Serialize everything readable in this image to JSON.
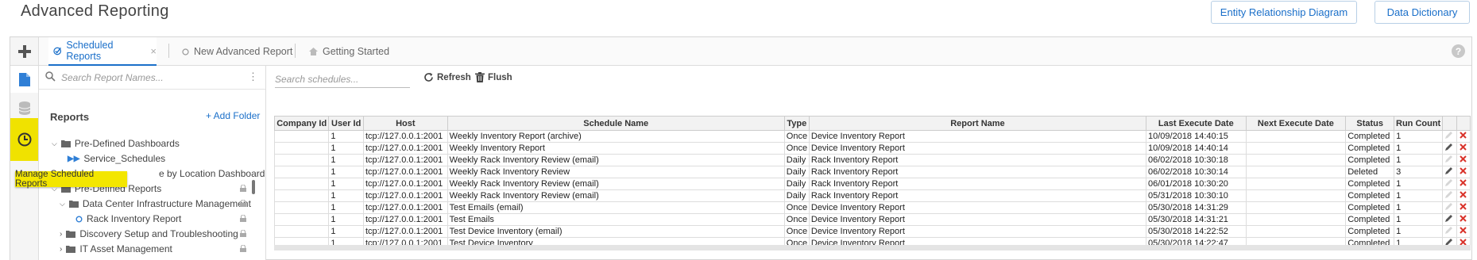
{
  "header": {
    "title": "Advanced Reporting",
    "erd_button": "Entity Relationship Diagram",
    "dictionary_button": "Data Dictionary"
  },
  "tabs": [
    {
      "label": "Scheduled Reports",
      "close": "×"
    },
    {
      "label": "New Advanced Report"
    },
    {
      "label": "Getting Started"
    }
  ],
  "help": "?",
  "tooltip": "Manage Scheduled Reports",
  "tree": {
    "search_placeholder": "Search Report Names...",
    "menu_glyph": "⋮",
    "heading": "Reports",
    "add_folder": "+ Add Folder",
    "items": [
      {
        "label": "Pre-Defined Dashboards"
      },
      {
        "label": "Service_Schedules"
      },
      {
        "label": "e by Location Dashboard"
      },
      {
        "label": "Pre-Defined Reports"
      },
      {
        "label": "Data Center Infrastructure Management"
      },
      {
        "label": "Rack Inventory Report"
      },
      {
        "label": "Discovery Setup and Troubleshooting"
      },
      {
        "label": "IT Asset Management"
      }
    ]
  },
  "toolbar": {
    "search_placeholder": "Search schedules...",
    "refresh": "Refresh",
    "flush": "Flush"
  },
  "table": {
    "columns": [
      "Company Id",
      "User Id",
      "Host",
      "Schedule Name",
      "Type",
      "Report Name",
      "Last Execute Date",
      "Next Execute Date",
      "Status",
      "Run Count",
      "",
      ""
    ],
    "rows": [
      {
        "company": "",
        "user": "1",
        "host": "tcp://127.0.0.1:2001",
        "name": "Weekly Inventory Report (archive)",
        "type": "Once",
        "report": "Device Inventory Report",
        "last": "10/09/2018 14:40:15",
        "next": "",
        "status": "Completed",
        "count": "1",
        "editable": false
      },
      {
        "company": "",
        "user": "1",
        "host": "tcp://127.0.0.1:2001",
        "name": "Weekly Inventory Report",
        "type": "Once",
        "report": "Device Inventory Report",
        "last": "10/09/2018 14:40:14",
        "next": "",
        "status": "Completed",
        "count": "1",
        "editable": true
      },
      {
        "company": "",
        "user": "1",
        "host": "tcp://127.0.0.1:2001",
        "name": "Weekly Rack Inventory Review (email)",
        "type": "Daily",
        "report": "Rack Inventory Report",
        "last": "06/02/2018 10:30:18",
        "next": "",
        "status": "Completed",
        "count": "1",
        "editable": false
      },
      {
        "company": "",
        "user": "1",
        "host": "tcp://127.0.0.1:2001",
        "name": "Weekly Rack Inventory Review",
        "type": "Daily",
        "report": "Rack Inventory Report",
        "last": "06/02/2018 10:30:14",
        "next": "",
        "status": "Deleted",
        "count": "3",
        "editable": true
      },
      {
        "company": "",
        "user": "1",
        "host": "tcp://127.0.0.1:2001",
        "name": "Weekly Rack Inventory Review (email)",
        "type": "Daily",
        "report": "Rack Inventory Report",
        "last": "06/01/2018 10:30:20",
        "next": "",
        "status": "Completed",
        "count": "1",
        "editable": false
      },
      {
        "company": "",
        "user": "1",
        "host": "tcp://127.0.0.1:2001",
        "name": "Weekly Rack Inventory Review (email)",
        "type": "Daily",
        "report": "Rack Inventory Report",
        "last": "05/31/2018 10:30:10",
        "next": "",
        "status": "Completed",
        "count": "1",
        "editable": false
      },
      {
        "company": "",
        "user": "1",
        "host": "tcp://127.0.0.1:2001",
        "name": "Test Emails (email)",
        "type": "Once",
        "report": "Device Inventory Report",
        "last": "05/30/2018 14:31:29",
        "next": "",
        "status": "Completed",
        "count": "1",
        "editable": false
      },
      {
        "company": "",
        "user": "1",
        "host": "tcp://127.0.0.1:2001",
        "name": "Test Emails",
        "type": "Once",
        "report": "Device Inventory Report",
        "last": "05/30/2018 14:31:21",
        "next": "",
        "status": "Completed",
        "count": "1",
        "editable": true
      },
      {
        "company": "",
        "user": "1",
        "host": "tcp://127.0.0.1:2001",
        "name": "Test Device Inventory (email)",
        "type": "Once",
        "report": "Device Inventory Report",
        "last": "05/30/2018 14:22:52",
        "next": "",
        "status": "Completed",
        "count": "1",
        "editable": false
      },
      {
        "company": "",
        "user": "1",
        "host": "tcp://127.0.0.1:2001",
        "name": "Test Device Inventory",
        "type": "Once",
        "report": "Device Inventory Report",
        "last": "05/30/2018 14:22:47",
        "next": "",
        "status": "Completed",
        "count": "1",
        "editable": true
      }
    ]
  },
  "colors": {
    "accent": "#1a6fc9",
    "highlight": "#f3e600",
    "delete": "#d9342b"
  }
}
